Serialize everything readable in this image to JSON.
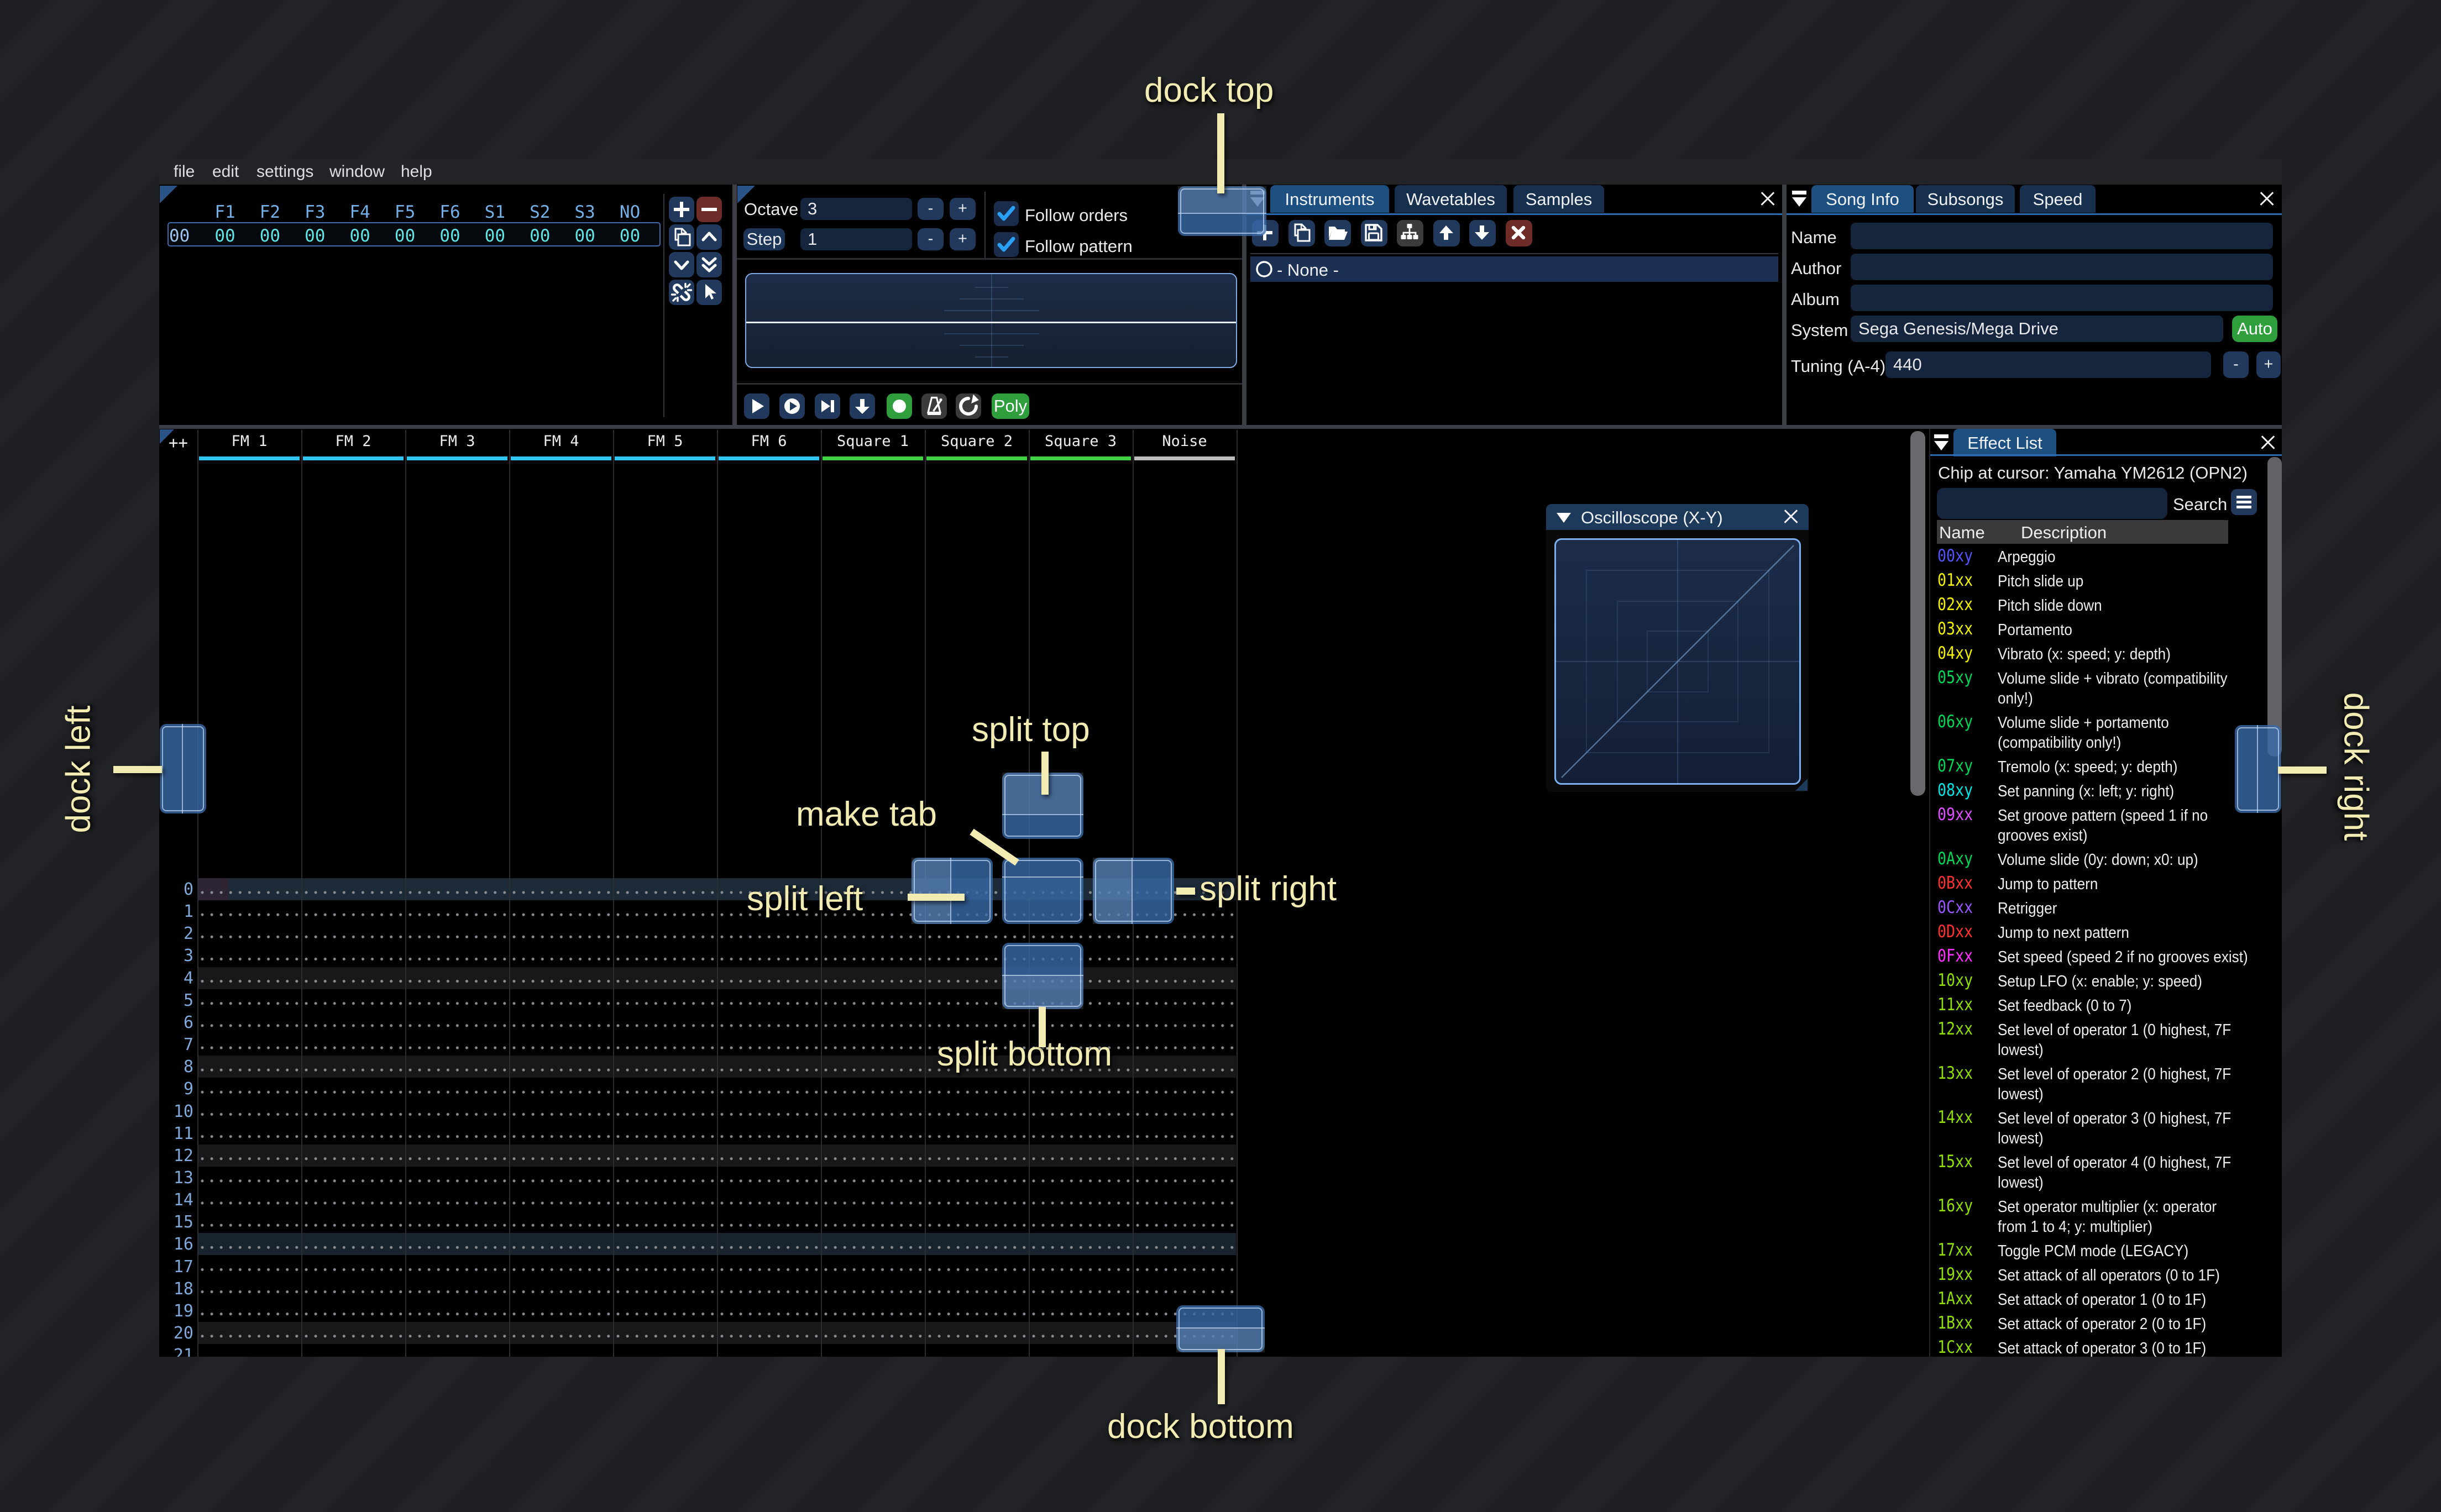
{
  "menu": {
    "items": [
      "file",
      "edit",
      "settings",
      "window",
      "help"
    ]
  },
  "orders": {
    "columns": [
      "F1",
      "F2",
      "F3",
      "F4",
      "F5",
      "F6",
      "S1",
      "S2",
      "S3",
      "NO"
    ],
    "row_index": "00",
    "row_values": [
      "00",
      "00",
      "00",
      "00",
      "00",
      "00",
      "00",
      "00",
      "00",
      "00"
    ],
    "buttons": [
      "add",
      "remove",
      "duplicate",
      "move-up",
      "move-down",
      "move-to-end",
      "unlink",
      "edit-mode"
    ]
  },
  "play_controls": {
    "octave_label": "Octave",
    "octave_value": "3",
    "step_label": "Step",
    "step_value": "1",
    "minus_label": "-",
    "plus_label": "+",
    "follow_orders_label": "Follow orders",
    "follow_pattern_label": "Follow pattern",
    "poly_label": "Poly"
  },
  "instruments": {
    "tabs": [
      "Instruments",
      "Wavetables",
      "Samples"
    ],
    "list_selected": "- None -"
  },
  "song_info": {
    "tabs": [
      "Song Info",
      "Subsongs",
      "Speed"
    ],
    "name_label": "Name",
    "name_value": "",
    "author_label": "Author",
    "author_value": "",
    "album_label": "Album",
    "album_value": "",
    "system_label": "System",
    "system_value": "Sega Genesis/Mega Drive",
    "auto_label": "Auto",
    "tuning_label": "Tuning (A-4)",
    "tuning_value": "440",
    "minus_label": "-",
    "plus_label": "+"
  },
  "pattern": {
    "corner_button": "++",
    "channels": [
      {
        "name": "FM 1",
        "type": "fm"
      },
      {
        "name": "FM 2",
        "type": "fm"
      },
      {
        "name": "FM 3",
        "type": "fm"
      },
      {
        "name": "FM 4",
        "type": "fm"
      },
      {
        "name": "FM 5",
        "type": "fm"
      },
      {
        "name": "FM 6",
        "type": "fm"
      },
      {
        "name": "Square 1",
        "type": "square"
      },
      {
        "name": "Square 2",
        "type": "square"
      },
      {
        "name": "Square 3",
        "type": "square"
      },
      {
        "name": "Noise",
        "type": "noise"
      }
    ],
    "row_count": 22,
    "channel_colors": {
      "fm": "#31c5f1",
      "square": "#3fd344",
      "noise": "#b8bcbe"
    }
  },
  "oscilloscope": {
    "title": "Oscilloscope (X-Y)"
  },
  "effect_list": {
    "title": "Effect List",
    "chip_line": "Chip at cursor: Yamaha YM2612 (OPN2)",
    "search_label": "Search",
    "search_value": "",
    "columns": [
      "Name",
      "Description"
    ],
    "rows": [
      {
        "code": "00xy",
        "color": "#5252ff",
        "desc": "Arpeggio",
        "lines": 1
      },
      {
        "code": "01xx",
        "color": "#f2f200",
        "desc": "Pitch slide up",
        "lines": 1
      },
      {
        "code": "02xx",
        "color": "#f2f200",
        "desc": "Pitch slide down",
        "lines": 1
      },
      {
        "code": "03xx",
        "color": "#f2f200",
        "desc": "Portamento",
        "lines": 1
      },
      {
        "code": "04xy",
        "color": "#f2f200",
        "desc": "Vibrato (x: speed; y: depth)",
        "lines": 1
      },
      {
        "code": "05xy",
        "color": "#00d858",
        "desc": "Volume slide + vibrato (compatibility only!)",
        "lines": 2
      },
      {
        "code": "06xy",
        "color": "#00d858",
        "desc": "Volume slide + portamento (compatibility only!)",
        "lines": 2
      },
      {
        "code": "07xy",
        "color": "#00d858",
        "desc": "Tremolo (x: speed; y: depth)",
        "lines": 1
      },
      {
        "code": "08xy",
        "color": "#00e5e5",
        "desc": "Set panning (x: left; y: right)",
        "lines": 1
      },
      {
        "code": "09xx",
        "color": "#e04fff",
        "desc": "Set groove pattern (speed 1 if no grooves exist)",
        "lines": 2
      },
      {
        "code": "0Axy",
        "color": "#00d858",
        "desc": "Volume slide (0y: down; x0: up)",
        "lines": 1
      },
      {
        "code": "0Bxx",
        "color": "#ff3030",
        "desc": "Jump to pattern",
        "lines": 1
      },
      {
        "code": "0Cxx",
        "color": "#9a55ff",
        "desc": "Retrigger",
        "lines": 1
      },
      {
        "code": "0Dxx",
        "color": "#ff3030",
        "desc": "Jump to next pattern",
        "lines": 1
      },
      {
        "code": "0Fxx",
        "color": "#ff2fff",
        "desc": "Set speed (speed 2 if no grooves exist)",
        "lines": 1
      },
      {
        "code": "10xy",
        "color": "#8fe000",
        "desc": "Setup LFO (x: enable; y: speed)",
        "lines": 1
      },
      {
        "code": "11xx",
        "color": "#8fe000",
        "desc": "Set feedback (0 to 7)",
        "lines": 1
      },
      {
        "code": "12xx",
        "color": "#8fe000",
        "desc": "Set level of operator 1 (0 highest, 7F lowest)",
        "lines": 2
      },
      {
        "code": "13xx",
        "color": "#8fe000",
        "desc": "Set level of operator 2 (0 highest, 7F lowest)",
        "lines": 2
      },
      {
        "code": "14xx",
        "color": "#8fe000",
        "desc": "Set level of operator 3 (0 highest, 7F lowest)",
        "lines": 2
      },
      {
        "code": "15xx",
        "color": "#8fe000",
        "desc": "Set level of operator 4 (0 highest, 7F lowest)",
        "lines": 2
      },
      {
        "code": "16xy",
        "color": "#8fe000",
        "desc": "Set operator multiplier (x: operator from 1 to 4; y: multiplier)",
        "lines": 2
      },
      {
        "code": "17xx",
        "color": "#8fe000",
        "desc": "Toggle PCM mode (LEGACY)",
        "lines": 1
      },
      {
        "code": "19xx",
        "color": "#8fe000",
        "desc": "Set attack of all operators (0 to 1F)",
        "lines": 1
      },
      {
        "code": "1Axx",
        "color": "#8fe000",
        "desc": "Set attack of operator 1 (0 to 1F)",
        "lines": 1
      },
      {
        "code": "1Bxx",
        "color": "#8fe000",
        "desc": "Set attack of operator 2 (0 to 1F)",
        "lines": 1
      },
      {
        "code": "1Cxx",
        "color": "#8fe000",
        "desc": "Set attack of operator 3 (0 to 1F)",
        "lines": 1
      }
    ]
  },
  "annotations": {
    "dock_top": "dock top",
    "dock_bottom": "dock bottom",
    "dock_left": "dock left",
    "dock_right": "dock right",
    "split_top": "split top",
    "split_bottom": "split bottom",
    "split_left": "split left",
    "split_right": "split right",
    "make_tab": "make tab"
  },
  "colors": {
    "accent_tab_active": "#1d4f80",
    "accent_tab_inactive": "#16304e",
    "frame_bg": "#16253e",
    "button_navy": "#20395c",
    "button_red": "#6f2b27",
    "button_green": "#2f9e3c",
    "checkmark": "#2aa0f5",
    "order_value": "#5ee6e6",
    "order_header": "#74b0e8",
    "row_number": "#7fabdd",
    "dock_indicator": "#3a68a4",
    "annotation": "#f2ecb2"
  }
}
